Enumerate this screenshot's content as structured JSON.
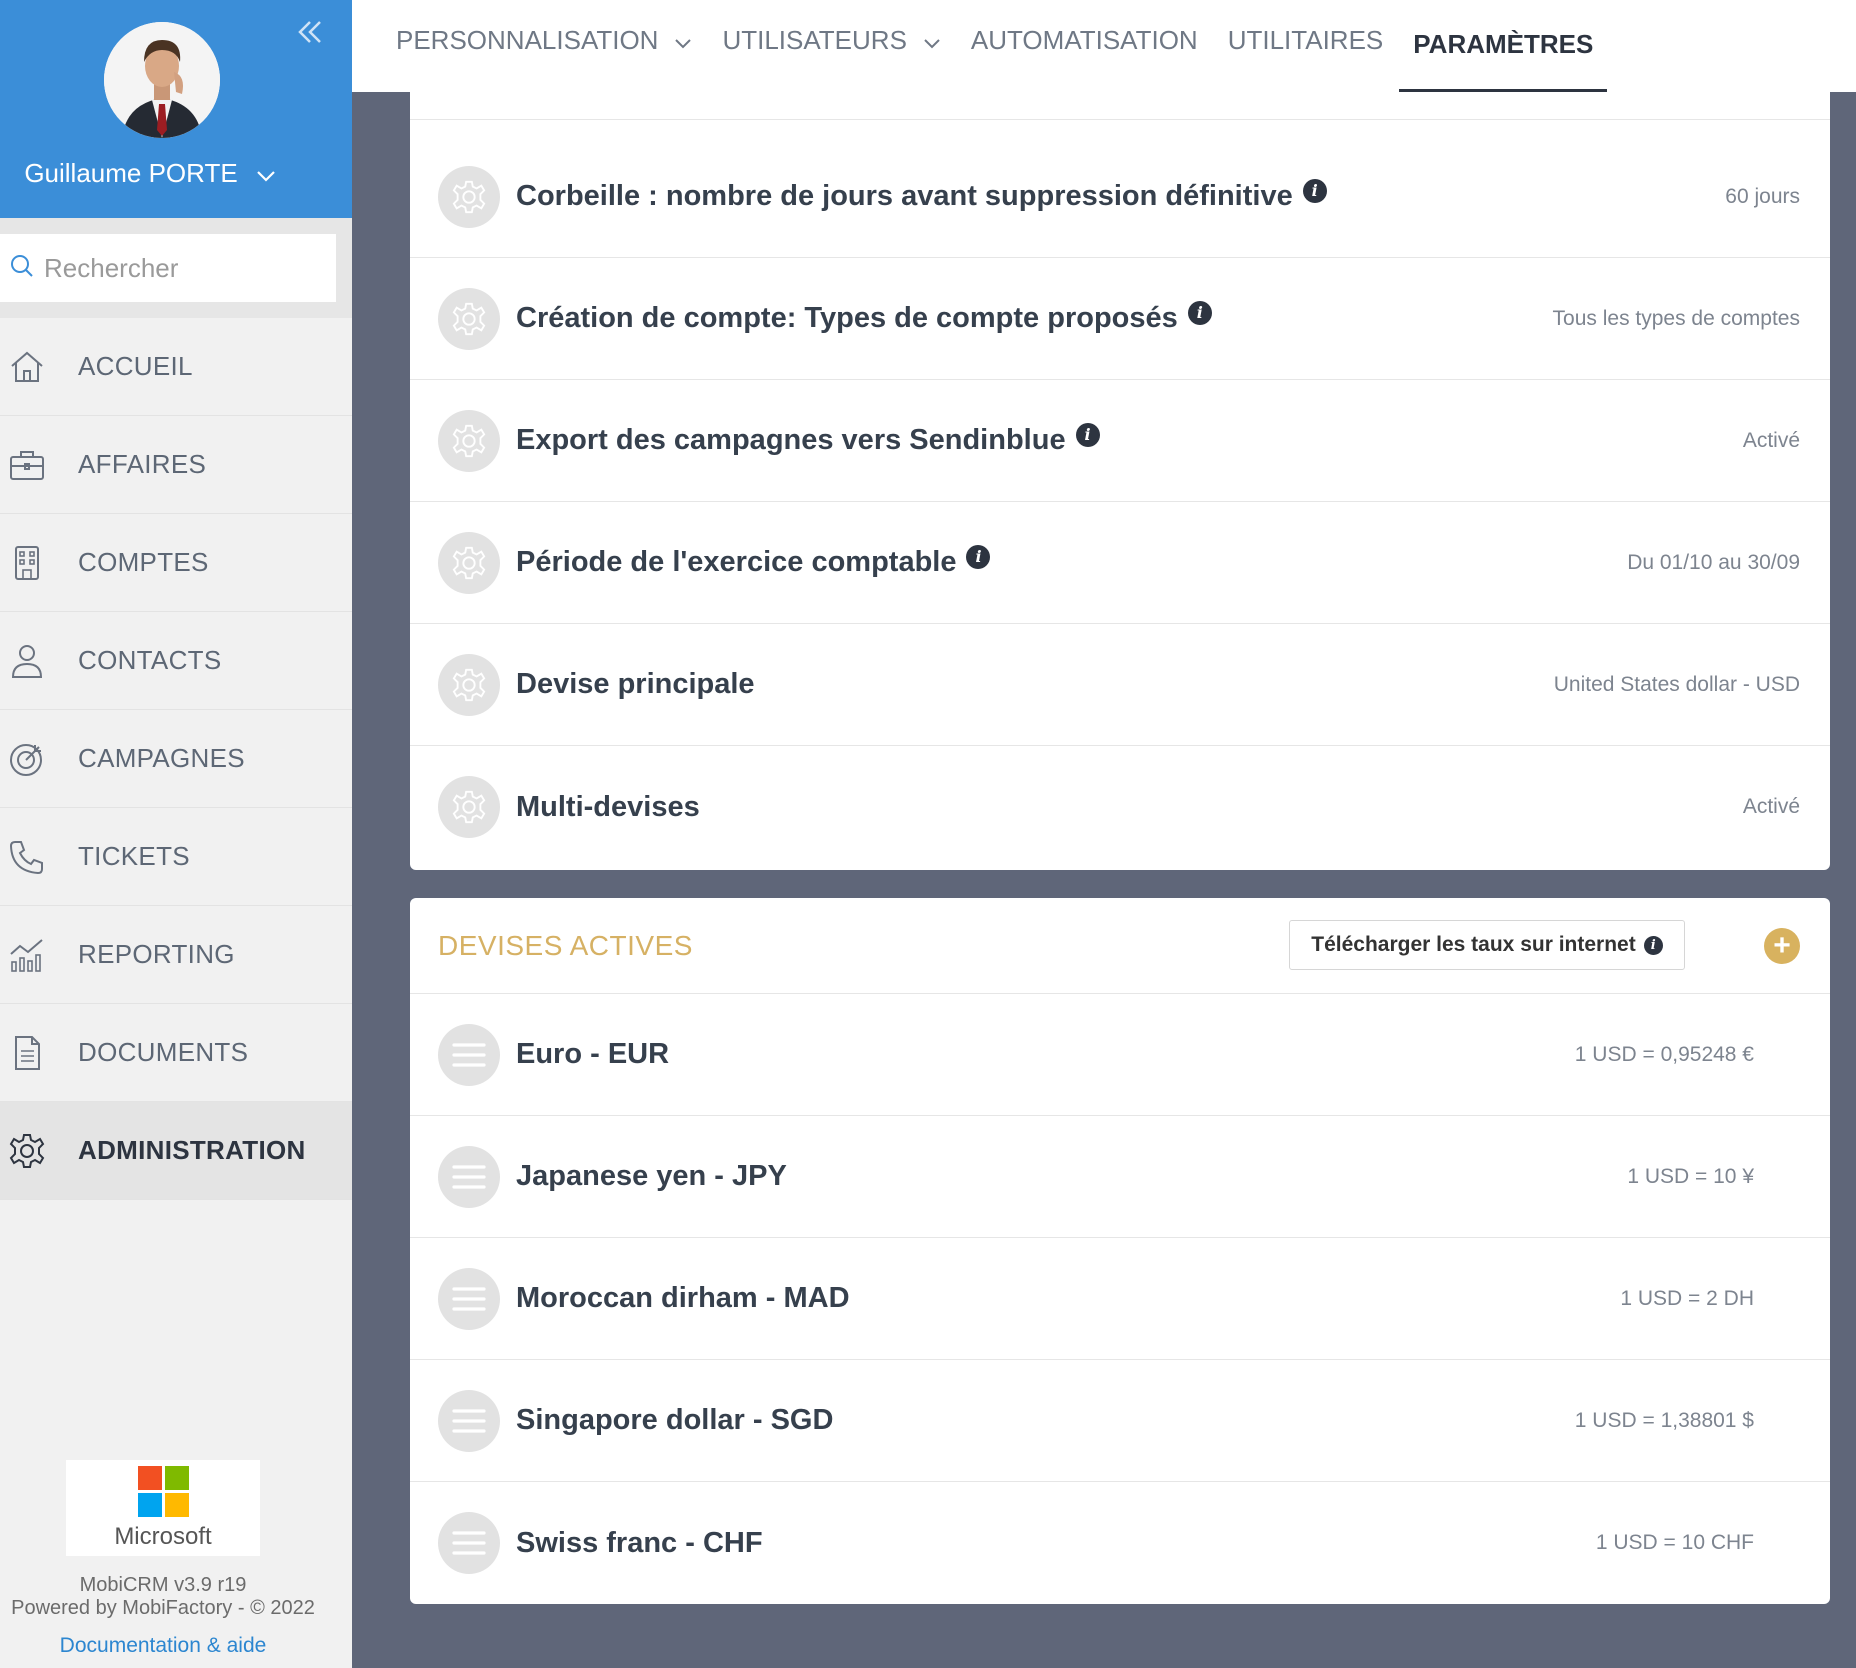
{
  "sidebar": {
    "user_name": "Guillaume PORTE",
    "search_placeholder": "Rechercher",
    "nav": [
      {
        "label": "ACCUEIL",
        "icon": "home-icon"
      },
      {
        "label": "AFFAIRES",
        "icon": "briefcase-icon"
      },
      {
        "label": "COMPTES",
        "icon": "building-icon"
      },
      {
        "label": "CONTACTS",
        "icon": "person-icon"
      },
      {
        "label": "CAMPAGNES",
        "icon": "target-icon"
      },
      {
        "label": "TICKETS",
        "icon": "phone-icon"
      },
      {
        "label": "REPORTING",
        "icon": "chart-icon"
      },
      {
        "label": "DOCUMENTS",
        "icon": "document-icon"
      },
      {
        "label": "ADMINISTRATION",
        "icon": "gear-icon",
        "active": true
      }
    ],
    "brand": "Microsoft",
    "version": "MobiCRM v3.9 r19",
    "powered_by": "Powered by MobiFactory - © 2022",
    "doc_link": "Documentation & aide"
  },
  "topnav": {
    "tabs": [
      {
        "label": "PERSONNALISATION",
        "dropdown": true
      },
      {
        "label": "UTILISATEURS",
        "dropdown": true
      },
      {
        "label": "AUTOMATISATION",
        "dropdown": false
      },
      {
        "label": "UTILITAIRES",
        "dropdown": false
      },
      {
        "label": "PARAMÈTRES",
        "dropdown": false,
        "active": true
      }
    ]
  },
  "settings": [
    {
      "title": "Corbeille : nombre de jours avant suppression définitive",
      "info": true,
      "value": "60 jours"
    },
    {
      "title": "Création de compte: Types de compte proposés",
      "info": true,
      "value": "Tous les types de comptes"
    },
    {
      "title": "Export des campagnes vers Sendinblue",
      "info": true,
      "value": "Activé"
    },
    {
      "title": "Période de l'exercice comptable",
      "info": true,
      "value": "Du 01/10 au 30/09"
    },
    {
      "title": "Devise principale",
      "info": false,
      "value": "United States dollar - USD"
    },
    {
      "title": "Multi-devises",
      "info": false,
      "value": "Activé"
    }
  ],
  "currencies": {
    "title": "DEVISES ACTIVES",
    "download_label": "Télécharger les taux sur internet",
    "add_label": "+",
    "items": [
      {
        "name": "Euro - EUR",
        "rate": "1 USD = 0,95248 €"
      },
      {
        "name": "Japanese yen - JPY",
        "rate": "1 USD = 10 ¥"
      },
      {
        "name": "Moroccan dirham - MAD",
        "rate": "1 USD = 2 DH"
      },
      {
        "name": "Singapore dollar - SGD",
        "rate": "1 USD = 1,38801 $"
      },
      {
        "name": "Swiss franc - CHF",
        "rate": "1 USD = 10 CHF"
      }
    ]
  },
  "colors": {
    "profile_bg": "#3b8ed8",
    "accent_gold": "#d6b164",
    "page_bg": "#5f6679",
    "link_blue": "#2c86d0"
  }
}
